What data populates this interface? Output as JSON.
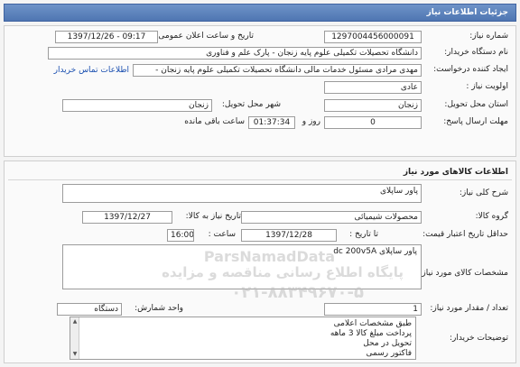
{
  "header": {
    "title": "جزئیات اطلاعات نیاز"
  },
  "info": {
    "need_number_label": "شماره نیاز:",
    "need_number": "1297004456000091",
    "announce_label": "تاریخ و ساعت اعلان عمومی:",
    "announce_value": "1397/12/26 - 09:17",
    "buyer_label": "نام دستگاه خریدار:",
    "buyer_value": "دانشگاه تحصیلات تکمیلی علوم پایه زنجان - پارک علم و فناوری",
    "creator_label": "ایجاد کننده درخواست:",
    "creator_value": "مهدی مرادی مسئول خدمات مالی دانشگاه تحصیلات تکمیلی علوم پایه زنجان -",
    "contact_link": "اطلاعات تماس خریدار",
    "priority_label": "اولویت نیاز :",
    "priority_value": "عادی",
    "province_label": "استان محل تحویل:",
    "province_value": "زنجان",
    "city_label": "شهر محل تحویل:",
    "city_value": "زنجان",
    "deadline_label": "مهلت ارسال پاسخ:",
    "deadline_days": "0",
    "days_unit": "روز و",
    "deadline_time": "01:37:34",
    "time_remaining": "ساعت باقی مانده"
  },
  "goods": {
    "section_title": "اطلاعات کالاهای مورد نیاز",
    "summary_label": "شرح کلی نیاز:",
    "summary_value": "پاور ساپلای",
    "group_label": "گروه کالا:",
    "group_value": "محصولات شیمیائی",
    "need_date_label": "تاریخ نیاز به کالا:",
    "need_date_value": "1397/12/27",
    "min_price_label": "حداقل تاریخ اعتبار قیمت:",
    "to_date_label": "تا تاریخ :",
    "to_date_value": "1397/12/28",
    "hour_label": "ساعت :",
    "hour_value": "16:00",
    "spec_label": "مشخصات کالای مورد نیاز:",
    "spec_value": "پاور ساپلای dc 200v5A",
    "watermark_top": "ParsNamadData",
    "watermark_line1": "پایگاه اطلاع رسانی مناقصه و مزایده",
    "watermark_line2": "۰۲۱-۸۸۳۴۹۶۷۰-۵",
    "qty_label": "تعداد / مقدار مورد نیاز:",
    "qty_value": "1",
    "unit_label": "واحد شمارش:",
    "unit_value": "دستگاه",
    "notes_label": "توضیحات خریدار:",
    "notes_lines": [
      "طبق مشخصات اعلامی",
      "پرداخت مبلغ کالا 3 ماهه",
      "تحویل در محل",
      "فاکتور رسمی"
    ]
  }
}
